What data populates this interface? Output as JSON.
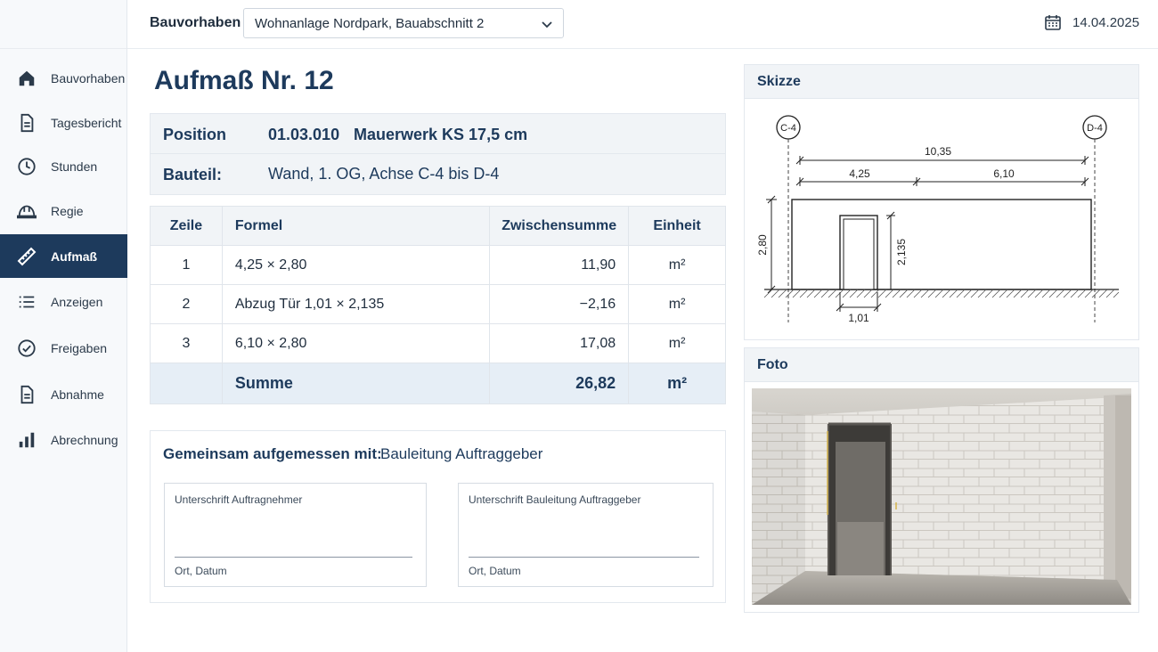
{
  "sidebar": {
    "items": [
      {
        "label": "Bauvorhaben",
        "icon": "home-icon",
        "active": false
      },
      {
        "label": "Tagesbericht",
        "icon": "document-icon",
        "active": false
      },
      {
        "label": "Stunden",
        "icon": "clock-icon",
        "active": false
      },
      {
        "label": "Regie",
        "icon": "hardhat-icon",
        "active": false
      },
      {
        "label": "Aufmaß",
        "icon": "ruler-icon",
        "active": true
      },
      {
        "label": "Anzeigen",
        "icon": "list-icon",
        "active": false
      },
      {
        "label": "Freigaben",
        "icon": "check-circle-icon",
        "active": false
      },
      {
        "label": "Abnahme",
        "icon": "document-icon",
        "active": false
      },
      {
        "label": "Abrechnung",
        "icon": "bar-chart-icon",
        "active": false
      }
    ]
  },
  "header": {
    "project_label": "Bauvorhaben",
    "project_value": "Wohnanlage Nordpark, Bauabschnitt 2",
    "date": "14.04.2025"
  },
  "main": {
    "title": "Aufmaß Nr. 12",
    "position_label": "Position",
    "position_number": "01.03.010",
    "position_description": "Mauerwerk KS 17,5 cm",
    "bauteil_label": "Bauteil:",
    "bauteil_value": "Wand, 1. OG, Achse C-4 bis D-4",
    "table": {
      "headers": {
        "zeile": "Zeile",
        "formel": "Formel",
        "zwischensumme": "Zwischensumme",
        "einheit": "Einheit"
      },
      "rows": [
        {
          "zeile": "1",
          "formel": "4,25 × 2,80",
          "zwischensumme": "11,90",
          "einheit": "m²"
        },
        {
          "zeile": "2",
          "formel": "Abzug Tür 1,01 × 2,135",
          "zwischensumme": "−2,16",
          "einheit": "m²"
        },
        {
          "zeile": "3",
          "formel": "6,10 × 2,80",
          "zwischensumme": "17,08",
          "einheit": "m²"
        }
      ],
      "sum": {
        "label": "Summe",
        "value": "26,82",
        "einheit": "m²"
      }
    },
    "signatures": {
      "label": "Gemeinsam aufgemessen mit:",
      "with": "Bauleitung Auftraggeber",
      "left": {
        "title": "Unterschrift Auftragnehmer",
        "footer": "Ort, Datum"
      },
      "right": {
        "title": "Unterschrift Bauleitung Auftraggeber",
        "footer": "Ort, Datum"
      }
    }
  },
  "sketch": {
    "title": "Skizze",
    "axis_left": "C-4",
    "axis_right": "D-4",
    "dim_total": "10,35",
    "dim_left": "4,25",
    "dim_right": "6,10",
    "dim_height": "2,80",
    "dim_door_height": "2,135",
    "dim_door_width": "1,01"
  },
  "photo": {
    "title": "Foto"
  },
  "colors": {
    "primary": "#1d3a5c",
    "sidebar_bg": "#f7f9fb",
    "table_header_bg": "#f1f4f7",
    "sum_row_bg": "#e6eef6"
  }
}
